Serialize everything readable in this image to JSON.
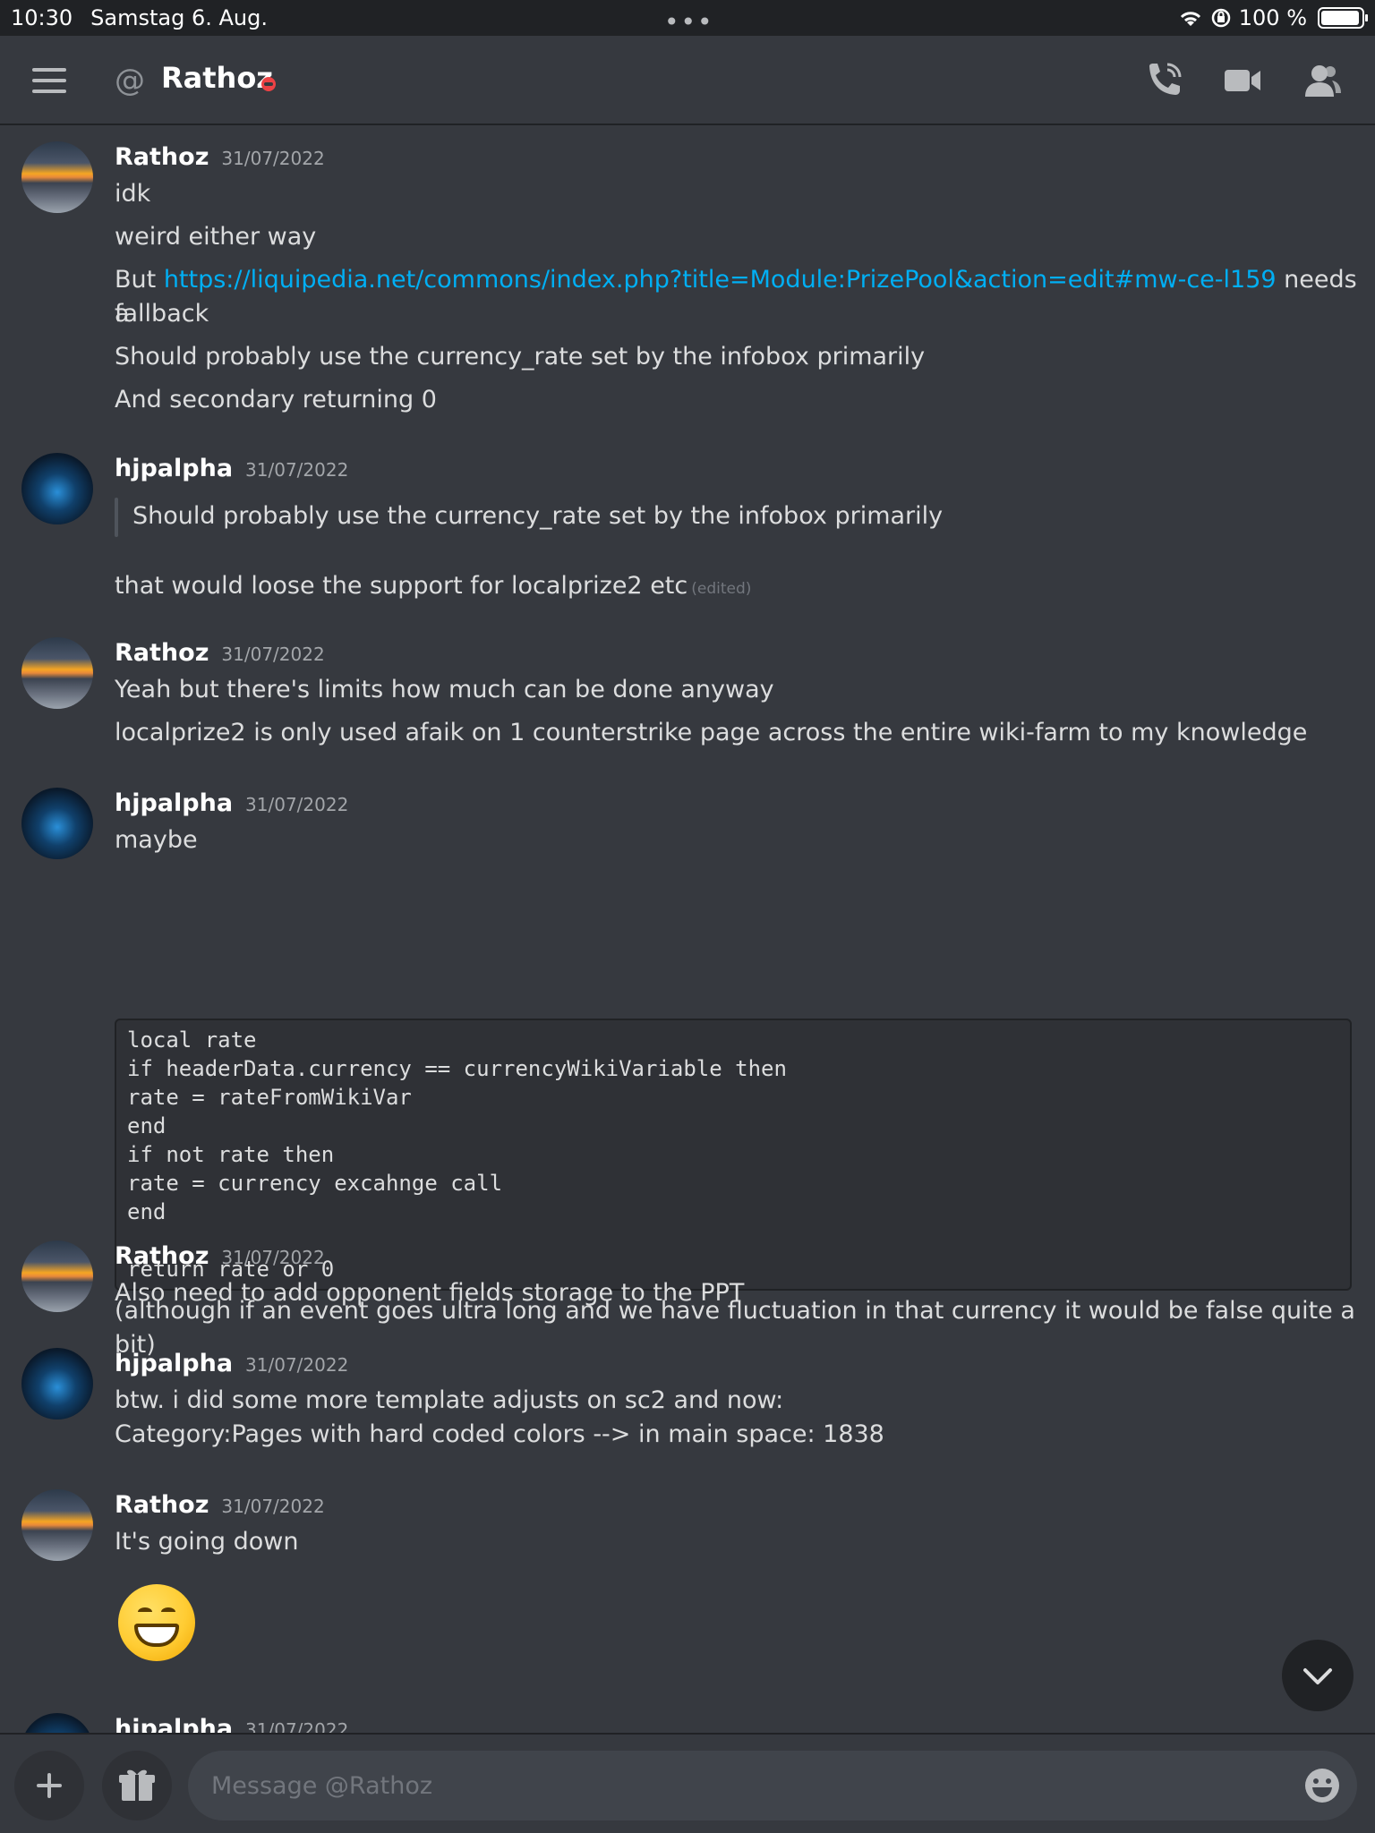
{
  "status_bar": {
    "time": "10:30",
    "date": "Samstag 6. Aug.",
    "battery": "100 %"
  },
  "header": {
    "channel_name": "Rathoz",
    "icons": [
      "menu-icon",
      "at-icon",
      "call-icon",
      "video-icon",
      "members-icon"
    ]
  },
  "messages": [
    {
      "author": "Rathoz",
      "timestamp": "31/07/2022",
      "lines": [
        "idk",
        "weird either way",
        "Should probably use the currency_rate set by the infobox primarily",
        "And secondary returning 0"
      ],
      "link_line": {
        "before": "But ",
        "url": "https://liquipedia.net/commons/index.php?title=Module:PrizePool&action=edit#mw-ce-l159",
        "after": " needs a",
        "wrap": "fallback"
      }
    },
    {
      "author": "hjpalpha",
      "timestamp": "31/07/2022",
      "quote": "Should probably use the currency_rate set by the infobox primarily",
      "text": "that would loose the support for localprize2 etc",
      "edited": "(edited)"
    },
    {
      "author": "Rathoz",
      "timestamp": "31/07/2022",
      "lines": [
        "Yeah but there's limits how much can be done anyway",
        "localprize2 is only used afaik on 1 counterstrike page across the entire wiki-farm to my knowledge"
      ]
    },
    {
      "author": "hjpalpha",
      "timestamp": "31/07/2022",
      "text": "maybe",
      "code": "local rate\nif headerData.currency == currencyWikiVariable then\nrate = rateFromWikiVar\nend\nif not rate then\nrate = currency excahnge call\nend\n\nreturn rate or 0",
      "after_code": "(although if an event goes ultra long and we have fluctuation in that currency it would be false quite a bit)"
    },
    {
      "author": "Rathoz",
      "timestamp": "31/07/2022",
      "text": "Also need to add opponent fields storage to the PPT"
    },
    {
      "author": "hjpalpha",
      "timestamp": "31/07/2022",
      "lines": [
        "btw. i did some more template adjusts on sc2 and now:",
        "Category:Pages with hard coded colors --> in main space: 1838"
      ]
    },
    {
      "author": "Rathoz",
      "timestamp": "31/07/2022",
      "text": "It's going down",
      "emoji": "grinning-face-emoji"
    },
    {
      "author": "hjpalpha",
      "timestamp": "31/07/2022"
    }
  ],
  "composer": {
    "placeholder": "Message @Rathoz",
    "add_icon": "plus-icon",
    "gift_icon": "gift-icon",
    "emoji_icon": "emoji-icon"
  },
  "colors": {
    "background": "#36393f",
    "link": "#00aff4",
    "dnd_status": "#ed4245"
  }
}
